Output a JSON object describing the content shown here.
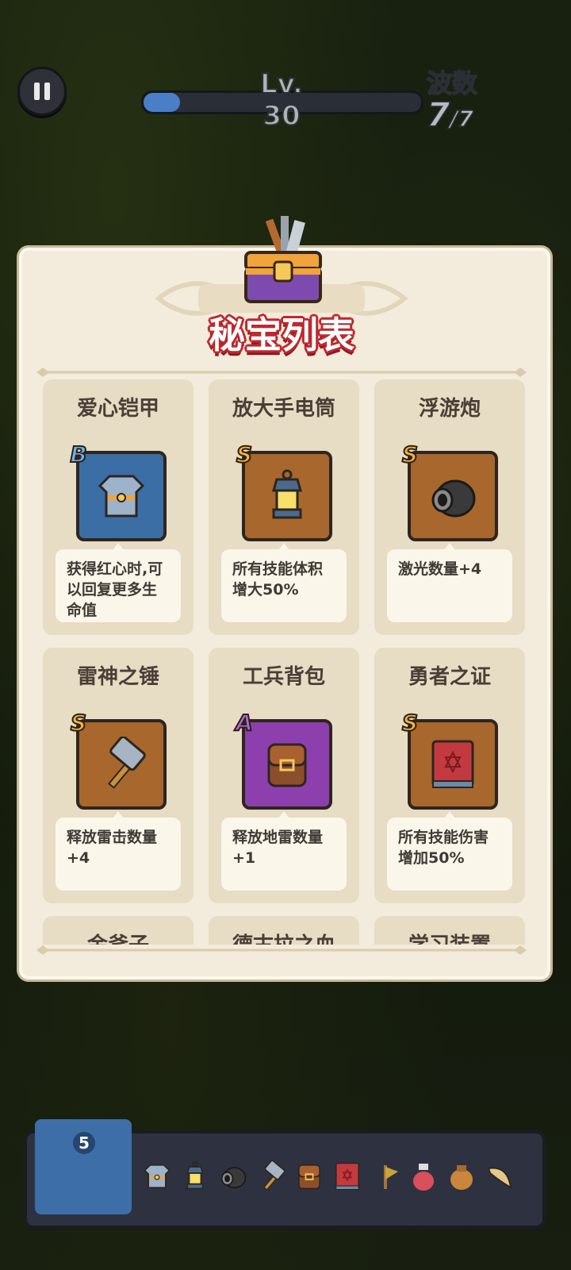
{
  "hud": {
    "level": "Lv. 30",
    "xp_progress": 0.13,
    "wave_label": "波数",
    "wave_current": "7",
    "wave_total": "/7"
  },
  "panel": {
    "title": "秘宝列表",
    "items": [
      {
        "name": "爱心铠甲",
        "rarity": "B",
        "icon": "armor-icon",
        "desc": "获得红心时,可以回复更多生命值",
        "frame": "#3b6ea5"
      },
      {
        "name": "放大手电筒",
        "rarity": "S",
        "icon": "lantern-icon",
        "desc": "所有技能体积增大50%",
        "frame": "#a8672c"
      },
      {
        "name": "浮游炮",
        "rarity": "S",
        "icon": "cannon-icon",
        "desc": "激光数量+4",
        "frame": "#a8672c"
      },
      {
        "name": "雷神之锤",
        "rarity": "S",
        "icon": "hammer-icon",
        "desc": "释放雷击数量+4",
        "frame": "#a8672c"
      },
      {
        "name": "工兵背包",
        "rarity": "A",
        "icon": "backpack-icon",
        "desc": "释放地雷数量+1",
        "frame": "#8e3fae"
      },
      {
        "name": "勇者之证",
        "rarity": "S",
        "icon": "book-icon",
        "desc": "所有技能伤害增加50%",
        "frame": "#a8672c"
      },
      {
        "name": "金斧子",
        "rarity": "",
        "icon": "",
        "desc": "",
        "frame": ""
      },
      {
        "name": "德古拉之血",
        "rarity": "",
        "icon": "",
        "desc": "",
        "frame": ""
      },
      {
        "name": "学习装置",
        "rarity": "",
        "icon": "",
        "desc": "",
        "frame": ""
      }
    ]
  },
  "bottom": {
    "book_count": "5",
    "slots": [
      "armor-icon",
      "lantern-icon",
      "cannon-icon",
      "hammer-icon",
      "backpack-icon",
      "book-icon",
      "axe-icon",
      "potion-icon",
      "bag-icon",
      "horn-icon"
    ]
  },
  "colors": {
    "rarity_B": "#6fb3e8",
    "rarity_S": "#f3b436",
    "rarity_A": "#b06ad6",
    "title_stroke": "#c1272d"
  }
}
